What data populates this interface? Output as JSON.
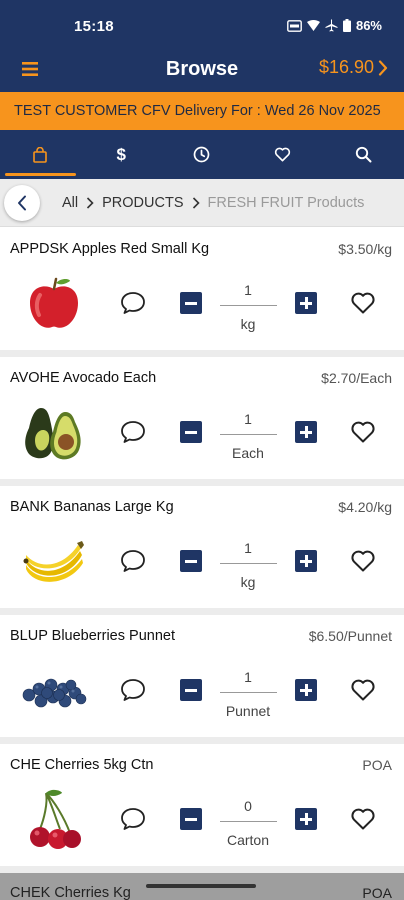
{
  "status_bar": {
    "time": "15:18",
    "battery": "86%"
  },
  "app_bar": {
    "title": "Browse",
    "cart_total": "$16.90"
  },
  "banner": {
    "text": "TEST CUSTOMER CFV Delivery For : Wed 26 Nov 2025"
  },
  "tabs": [
    {
      "icon": "shopping-bag-icon",
      "active": true
    },
    {
      "icon": "dollar-icon",
      "label": "$",
      "active": false
    },
    {
      "icon": "clock-icon",
      "active": false
    },
    {
      "icon": "heart-icon",
      "active": false
    },
    {
      "icon": "search-icon",
      "active": false
    }
  ],
  "breadcrumb": {
    "items": [
      "All",
      "PRODUCTS",
      "FRESH FRUIT Products"
    ]
  },
  "products": [
    {
      "name": "APPDSK Apples Red Small Kg",
      "price": "$3.50/kg",
      "qty": "1",
      "unit": "kg",
      "image": "apple-image"
    },
    {
      "name": "AVOHE Avocado  Each",
      "price": "$2.70/Each",
      "qty": "1",
      "unit": "Each",
      "image": "avocado-image"
    },
    {
      "name": "BANK Bananas Large Kg",
      "price": "$4.20/kg",
      "qty": "1",
      "unit": "kg",
      "image": "banana-image"
    },
    {
      "name": "BLUP Blueberries Punnet",
      "price": "$6.50/Punnet",
      "qty": "1",
      "unit": "Punnet",
      "image": "blueberry-image"
    },
    {
      "name": "CHE Cherries 5kg Ctn",
      "price": "POA",
      "qty": "0",
      "unit": "Carton",
      "image": "cherry-image"
    },
    {
      "name": "CHEK Cherries Kg",
      "price": "POA"
    }
  ],
  "colors": {
    "navy": "#1f3564",
    "orange": "#f7941d"
  }
}
